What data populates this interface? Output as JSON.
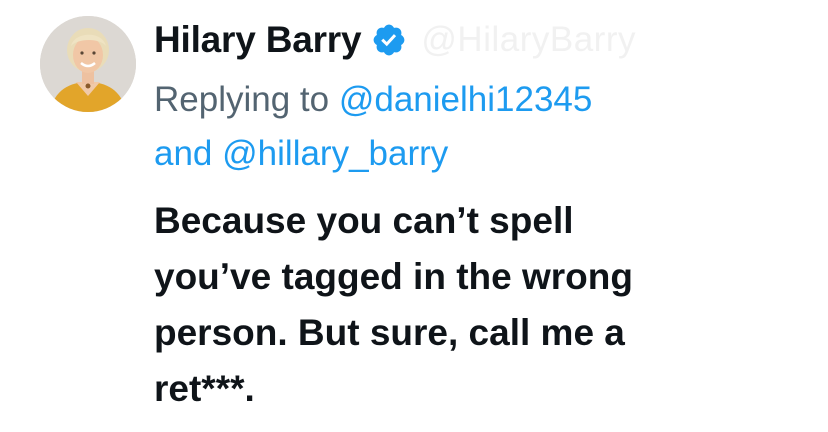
{
  "tweet": {
    "author": {
      "display_name": "Hilary Barry",
      "verified_icon": "verified-badge-icon",
      "avatar_icon": "profile-avatar",
      "faded_handle": "@HilaryBarry"
    },
    "reply": {
      "prefix": "Replying to",
      "mention_1": "@danielhi12345",
      "conjunction": "and",
      "mention_2": "@hillary_barry"
    },
    "text_lines": [
      "Because you can’t spell",
      "you’ve tagged in the wrong",
      "person. But sure, call me a",
      "ret***."
    ]
  },
  "colors": {
    "accent": "#1d9bf0",
    "text": "#0f1419",
    "secondary": "#536471",
    "background": "#ffffff"
  }
}
